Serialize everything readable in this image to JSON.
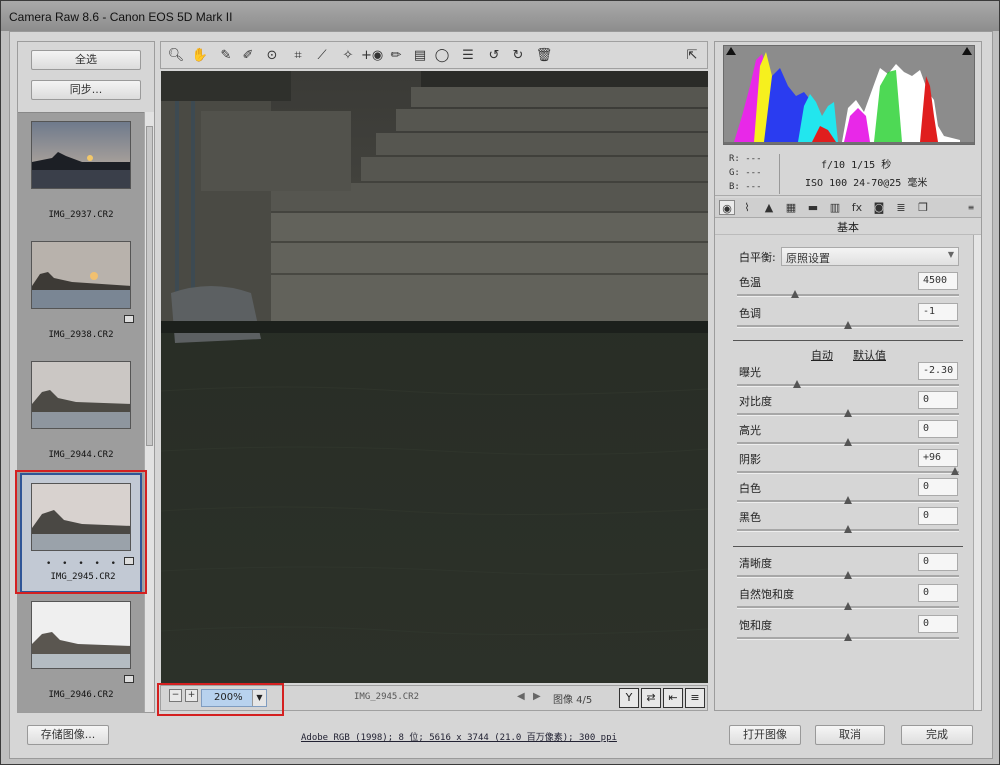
{
  "window": {
    "title": "Camera Raw 8.6 -  Canon EOS 5D Mark II"
  },
  "filmstrip": {
    "select_all": "全选",
    "sync": "同步...",
    "items": [
      {
        "name": "IMG_2937.CR2"
      },
      {
        "name": "IMG_2938.CR2"
      },
      {
        "name": "IMG_2944.CR2"
      },
      {
        "name": "IMG_2945.CR2",
        "rating": "• • • • •"
      },
      {
        "name": "IMG_2946.CR2"
      }
    ]
  },
  "toolbar": {
    "icons": [
      "zoom-icon",
      "hand-icon",
      "white-balance-icon",
      "color-sampler-icon",
      "target-adjust-icon",
      "crop-icon",
      "straighten-icon",
      "spot-removal-icon",
      "red-eye-icon",
      "adjustment-brush-icon",
      "graduated-filter-icon",
      "radial-filter-icon",
      "preferences-icon",
      "rotate-left-icon",
      "rotate-right-icon",
      "trash-icon"
    ],
    "fullscreen_icon": "fullscreen-icon"
  },
  "status_bar": {
    "zoom_out": "−",
    "zoom_in": "+",
    "zoom": "200%",
    "filename": "IMG_2945.CR2",
    "image_counter": "图像 4/5"
  },
  "histogram": {
    "r": "R:  ---",
    "g": "G:  ---",
    "b": "B:  ---",
    "aperture_shutter": "f/10   1/15 秒",
    "iso_lens": "ISO 100   24-70@25 毫米",
    "colors": {
      "red": "#e01e1e",
      "green": "#22d02a",
      "blue": "#2a3cf0",
      "yellow": "#f6f01e",
      "magenta": "#e828e8",
      "cyan": "#22e6ee",
      "white": "#ffffff"
    }
  },
  "panel": {
    "title": "基本",
    "white_balance_label": "白平衡:",
    "white_balance_value": "原照设置",
    "auto": "自动",
    "default": "默认值",
    "sliders": [
      {
        "label": "色温",
        "value": "4500",
        "pos": 0.26
      },
      {
        "label": "色调",
        "value": "-1",
        "pos": 0.5
      },
      {
        "label": "曝光",
        "value": "-2.30",
        "pos": 0.27
      },
      {
        "label": "对比度",
        "value": "0",
        "pos": 0.5
      },
      {
        "label": "高光",
        "value": "0",
        "pos": 0.5
      },
      {
        "label": "阴影",
        "value": "+96",
        "pos": 0.98
      },
      {
        "label": "白色",
        "value": "0",
        "pos": 0.5
      },
      {
        "label": "黑色",
        "value": "0",
        "pos": 0.5
      },
      {
        "label": "清晰度",
        "value": "0",
        "pos": 0.5
      },
      {
        "label": "自然饱和度",
        "value": "0",
        "pos": 0.5
      },
      {
        "label": "饱和度",
        "value": "0",
        "pos": 0.5
      }
    ]
  },
  "bottom": {
    "save": "存储图像...",
    "info": "Adobe RGB (1998); 8 位; 5616 x 3744 (21.0 百万像素); 300 ppi",
    "open": "打开图像",
    "cancel": "取消",
    "done": "完成"
  }
}
